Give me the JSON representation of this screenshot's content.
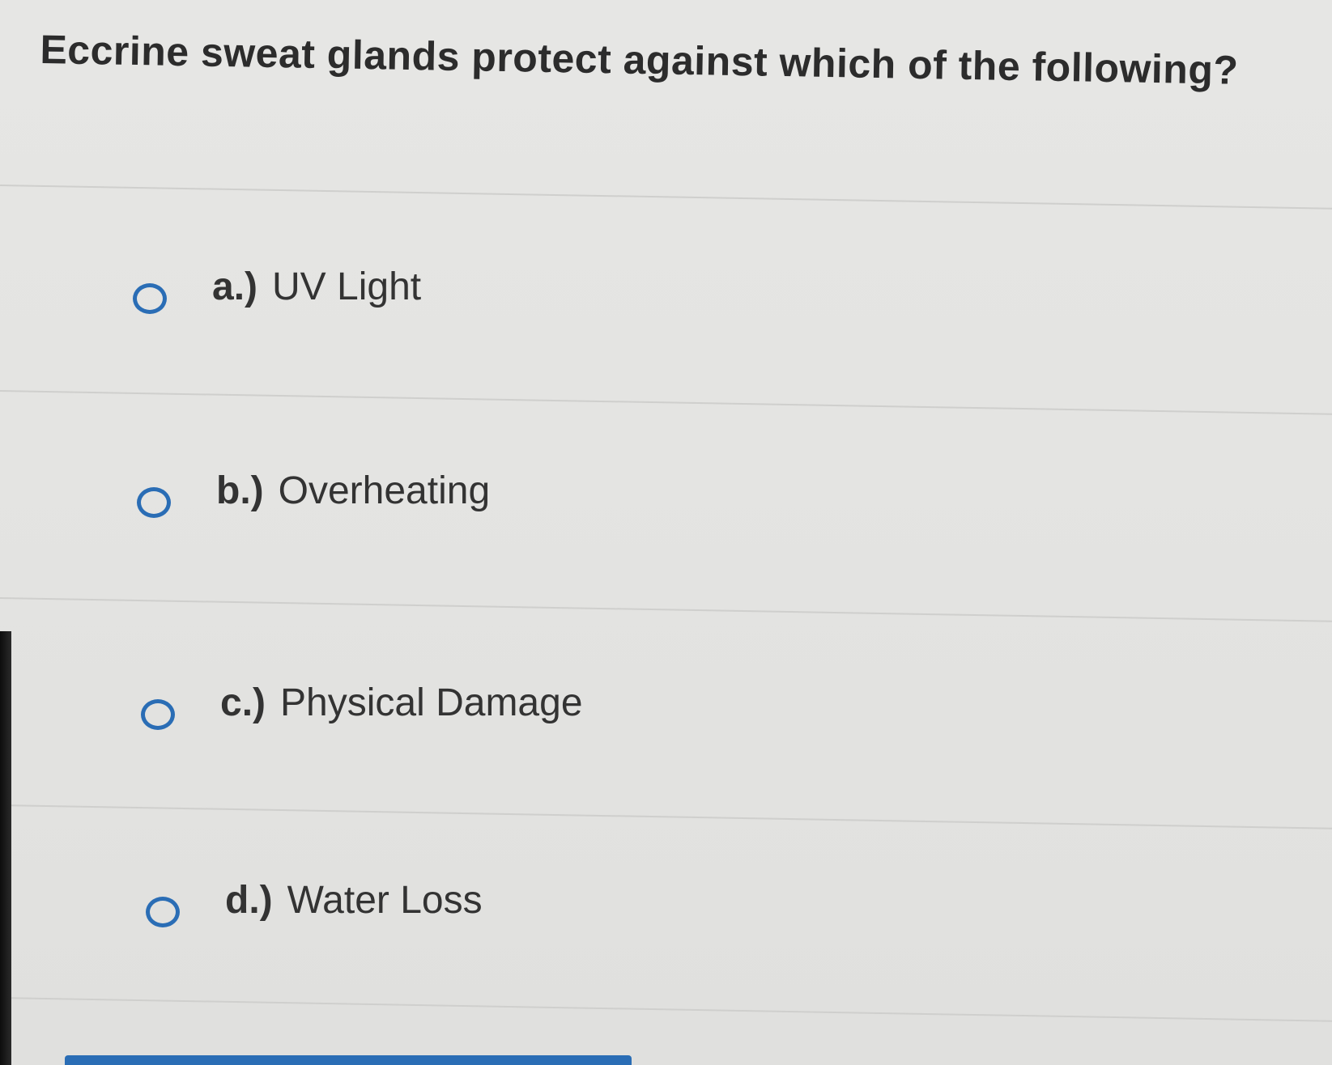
{
  "question": {
    "text": "Eccrine sweat glands protect against which of the following?"
  },
  "options": [
    {
      "letter": "a.)",
      "label": "UV Light",
      "selected": false
    },
    {
      "letter": "b.)",
      "label": "Overheating",
      "selected": false
    },
    {
      "letter": "c.)",
      "label": "Physical Damage",
      "selected": false
    },
    {
      "letter": "d.)",
      "label": "Water Loss",
      "selected": false
    }
  ],
  "colors": {
    "accent": "#2a6db5",
    "background": "#e4e4e2",
    "text": "#333333"
  },
  "icons": {
    "radio": "radio-unchecked-icon"
  }
}
